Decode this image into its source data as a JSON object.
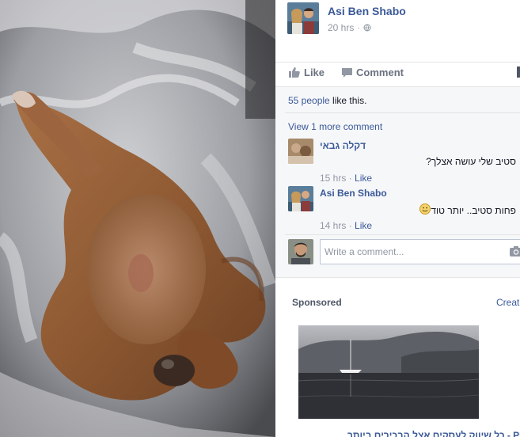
{
  "post": {
    "author": "Asi Ben Shabo",
    "time": "20 hrs",
    "meta_separator": "·"
  },
  "actions": {
    "like_label": "Like",
    "comment_label": "Comment"
  },
  "feedback": {
    "likes_count_link": "55 people",
    "likes_suffix": " like this.",
    "view_more": "View 1 more comment"
  },
  "comments": [
    {
      "name": "דקלה גבאי",
      "text": "סטיב שלי עושה אצלך?",
      "time": "15 hrs",
      "separator": " · ",
      "like_label": "Like"
    },
    {
      "name": "Asi Ben Shabo",
      "text": "פחות סטיב.. יותר טוד",
      "time": "14 hrs",
      "separator": " · ",
      "like_label": "Like"
    }
  ],
  "composer": {
    "placeholder": "Write a comment..."
  },
  "sponsored": {
    "label": "Sponsored",
    "create_ad": "Create Ad",
    "ad_title": "יום PRO - כל שיווק לעסקים אצל הבכירים ביותר"
  },
  "colors": {
    "link": "#3b5998",
    "muted": "#9197a3",
    "panel_bg": "#f6f7f9"
  },
  "icons": {
    "like": "thumbs-up-icon",
    "comment": "speech-bubble-icon",
    "camera": "camera-icon",
    "globe": "globe-icon",
    "smiley": "smiley-emoticon"
  }
}
